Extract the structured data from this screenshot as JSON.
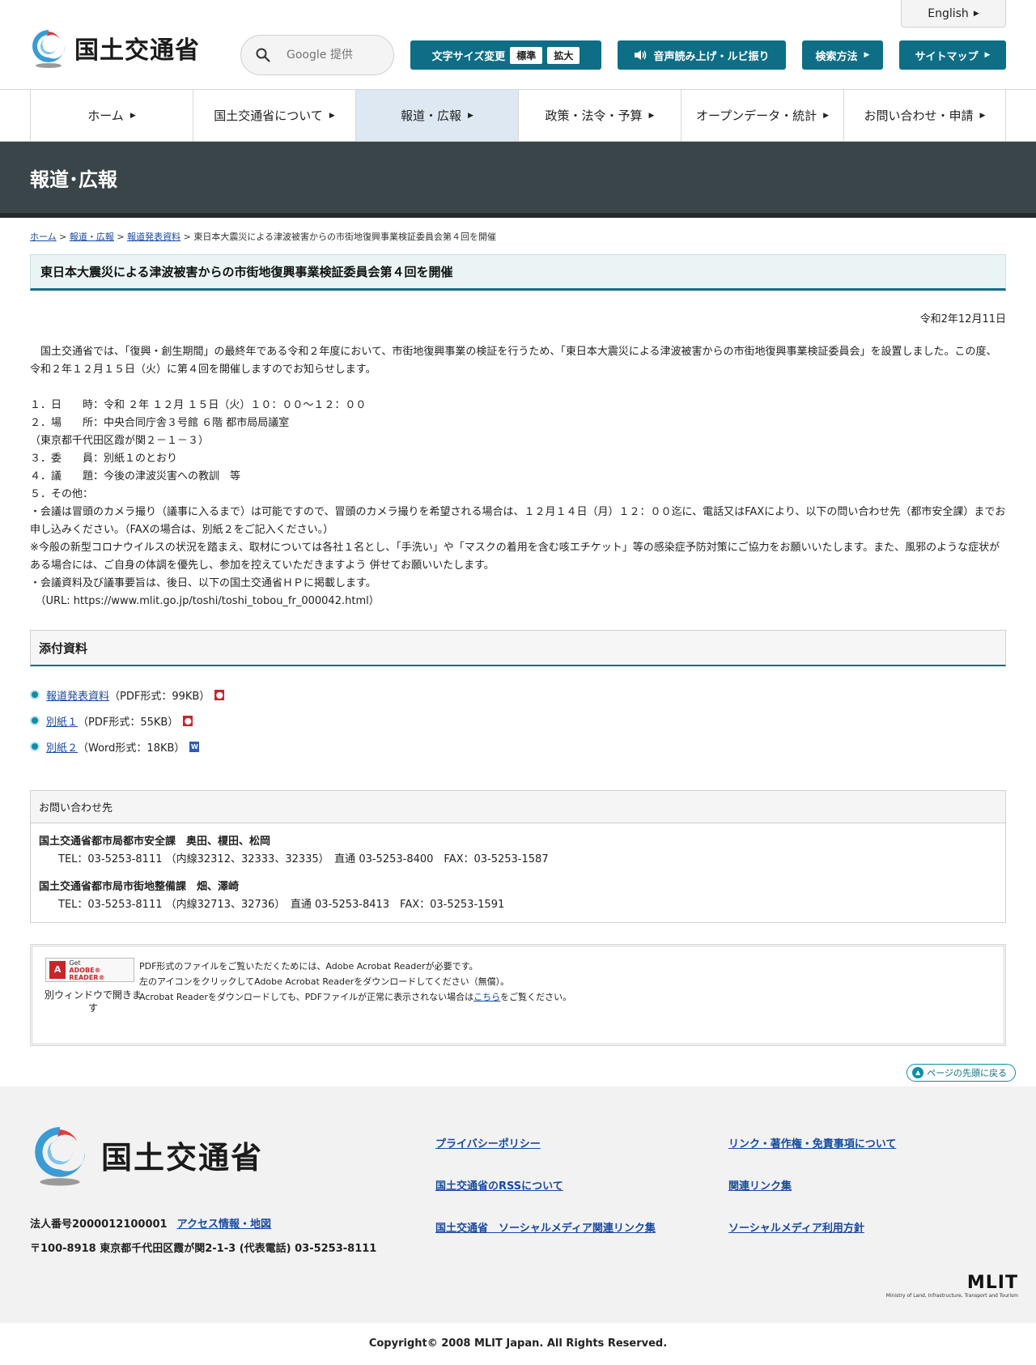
{
  "header": {
    "logo_text": "国土交通省",
    "search_placeholder": "Google 提供",
    "english_label": "English",
    "font_size_label": "文字サイズ変更",
    "font_size_standard": "標準",
    "font_size_large": "拡大",
    "voice_label": "音声読み上げ・ルビ振り",
    "howto_label": "検索方法",
    "sitemap_label": "サイトマップ"
  },
  "nav": {
    "items": [
      {
        "label": "ホーム"
      },
      {
        "label": "国土交通省について"
      },
      {
        "label": "報道・広報"
      },
      {
        "label": "政策・法令・予算"
      },
      {
        "label": "オープンデータ・統計"
      },
      {
        "label": "お問い合わせ・申請"
      }
    ]
  },
  "banner": {
    "title": "報道･広報"
  },
  "breadcrumb": {
    "home": "ホーム",
    "news": "報道・広報",
    "releases": "報道発表資料",
    "current": "東日本大震災による津波被害からの市街地復興事業検証委員会第４回を開催"
  },
  "article": {
    "title": "東日本大震災による津波被害からの市街地復興事業検証委員会第４回を開催",
    "date": "令和2年12月11日",
    "intro": "　国土交通省では、「復興・創生期間」の最終年である令和２年度において、市街地復興事業の検証を行うため、「東日本大震災による津波被害からの市街地復興事業検証委員会」を設置しました。この度、令和２年１２月１５日（火）に第４回を開催しますのでお知らせします。",
    "item1": "１．日　　時：令和 ２年 １２月 １５日（火）１０：００～１２：００",
    "item2": "２．場　　所：中央合同庁舎３号館 ６階 都市局局議室",
    "item2b": "（東京都千代田区霞が関２－１－３）",
    "item3": "３．委　　員：別紙１のとおり",
    "item4": "４．議　　題：今後の津波災害への教訓　等",
    "item5": "５．その他：",
    "note1": "・会議は冒頭のカメラ撮り（議事に入るまで）は可能ですので、冒頭のカメラ撮りを希望される場合は、１２月１４日（月）１２：００迄に、電話又はFAXにより、以下の問い合わせ先（都市安全課）までお申し込みください。（FAXの場合は、別紙２をご記入ください。）",
    "note2": "※今般の新型コロナウイルスの状況を踏まえ、取材については各社１名とし、「手洗い」や「マスクの着用を含む咳エチケット」等の感染症予防対策にご協力をお願いいたします。また、風邪のような症状がある場合には、ご自身の体調を優先し、参加を控えていただきますよう 併せてお願いいたします。",
    "note3": "・会議資料及び議事要旨は、後日、以下の国土交通省ＨＰに掲載します。",
    "note4": "　（URL: https://www.mlit.go.jp/toshi/toshi_tobou_fr_000042.html）"
  },
  "attachments": {
    "heading": "添付資料",
    "items": [
      {
        "link": "報道発表資料",
        "info": "（PDF形式：99KB）",
        "icon": "pdf-icon"
      },
      {
        "link": "別紙１",
        "info": "（PDF形式：55KB）",
        "icon": "pdf-icon"
      },
      {
        "link": "別紙２",
        "info": "（Word形式：18KB）",
        "icon": "word-icon"
      }
    ]
  },
  "contact": {
    "heading": "お問い合わせ先",
    "org1": "国土交通省都市局都市安全課　奥田、榎田、松岡",
    "tel1": "TEL：03-5253-8111 （内線32312、32333、32335）　直通 03-5253-8400　FAX：03-5253-1587",
    "org2": "国土交通省都市局市街地整備課　畑、澤崎",
    "tel2": "TEL：03-5253-8111 （内線32713、32736）　直通 03-5253-8413　FAX：03-5253-1591"
  },
  "reader": {
    "badge_get": "Get",
    "badge_name": "ADOBE® READER®",
    "note": "別ウィンドウで開きます",
    "line1": "PDF形式のファイルをご覧いただくためには、Adobe Acrobat Readerが必要です。",
    "line2": "左のアイコンをクリックしてAdobe Acrobat Readerをダウンロードしてください（無償）。",
    "line3a": "Acrobat Readerをダウンロードしても、PDFファイルが正常に表示されない場合は",
    "line3link": "こちら",
    "line3b": "をご覧ください。"
  },
  "pagetop": {
    "label": "ページの先頭に戻る"
  },
  "footer": {
    "logo_text": "国土交通省",
    "corp_number": "法人番号2000012100001",
    "access_link": "アクセス情報・地図",
    "address": "〒100-8918 東京都千代田区霞が関2-1-3 (代表電話) 03-5253-8111",
    "links": [
      "プライバシーポリシー",
      "リンク・著作権・免責事項について",
      "国土交通省のRSSについて",
      "関連リンク集",
      "国土交通省　ソーシャルメディア関連リンク集",
      "ソーシャルメディア利用方針"
    ],
    "mlit_big": "MLIT",
    "mlit_small": "Ministry of Land, Infrastructure, Transport and Tourism",
    "copyright": "Copyright© 2008 MLIT Japan. All Rights Reserved."
  }
}
